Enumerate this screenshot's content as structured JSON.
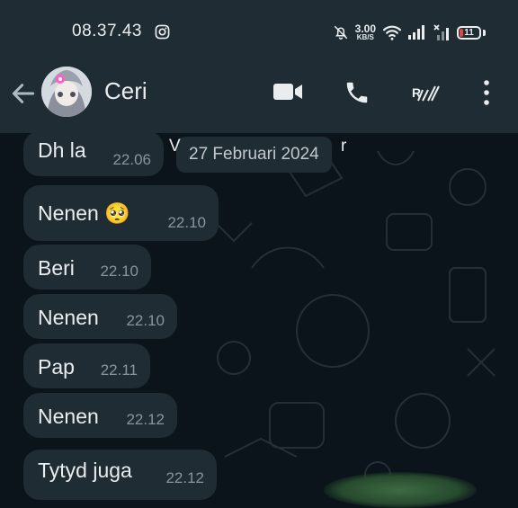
{
  "status_bar": {
    "time": "08.37.43",
    "net_speed_value": "3.00",
    "net_speed_unit": "KB/S",
    "battery": "11",
    "battery_color": "#e0473e"
  },
  "header": {
    "contact_name": "Ceri",
    "icons": [
      "back-arrow-icon",
      "video-call-icon",
      "phone-call-icon",
      "tick-icon",
      "more-options-icon"
    ]
  },
  "chat": {
    "date_chip": "27 Februari 2024",
    "partial_system_left": "V",
    "partial_system_right": "r",
    "messages": [
      {
        "text": "Dh la",
        "time": "22.06"
      },
      {
        "text": "Nenen 🥺",
        "time": "22.10"
      },
      {
        "text": "Beri",
        "time": "22.10"
      },
      {
        "text": "Nenen",
        "time": "22.10"
      },
      {
        "text": "Pap",
        "time": "22.11"
      },
      {
        "text": "Nenen",
        "time": "22.12"
      },
      {
        "text": "Tytyd juga",
        "time": "22.12"
      }
    ]
  },
  "colors": {
    "header_bg": "#1f2c34",
    "chat_bg": "#0b141a",
    "bubble_bg": "#1f2c34",
    "text": "#e9edef",
    "meta": "#8696a0"
  }
}
